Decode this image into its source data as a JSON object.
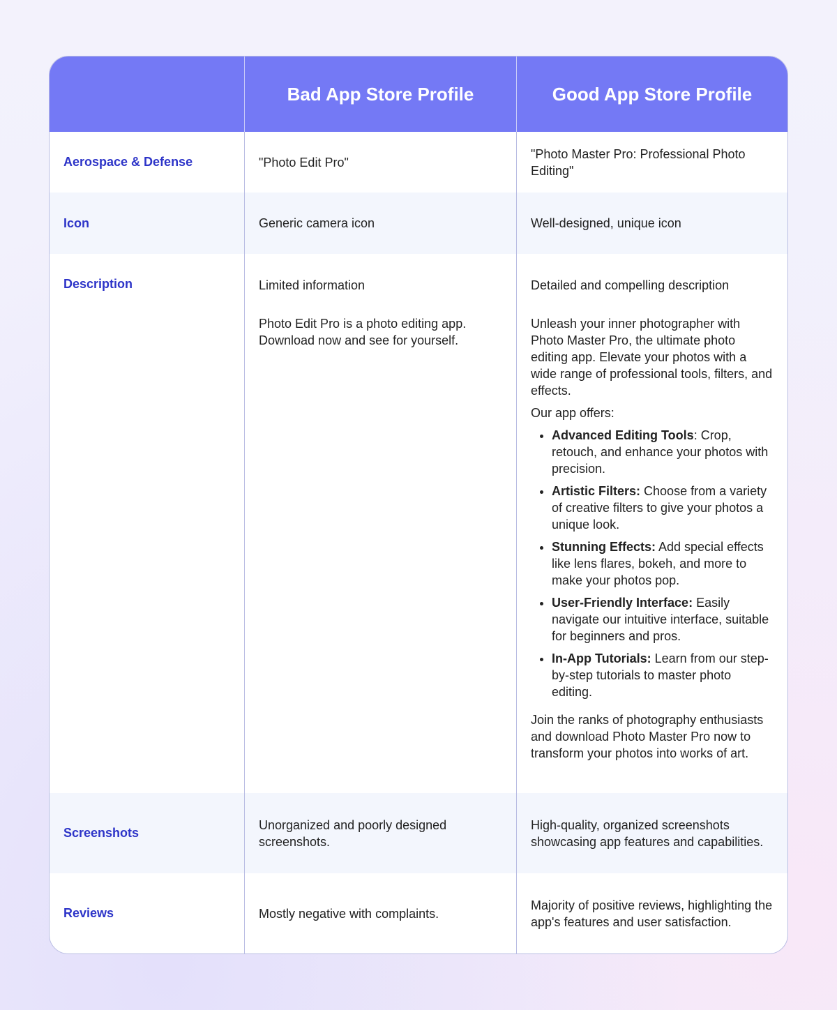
{
  "header": {
    "col1": "",
    "col2": "Bad App Store Profile",
    "col3": "Good App Store Profile"
  },
  "rows": {
    "name": {
      "label": "Aerospace & Defense",
      "bad": "\"Photo Edit Pro\"",
      "good": "\"Photo Master Pro: Professional Photo Editing\""
    },
    "icon": {
      "label": "Icon",
      "bad": "Generic camera icon",
      "good": "Well-designed, unique icon"
    },
    "description": {
      "label": "Description",
      "bad_title": "Limited information",
      "bad_body": "Photo Edit Pro is a photo editing app. Download now and see for yourself.",
      "good_title": "Detailed and compelling description",
      "good_intro": "Unleash your inner photographer with Photo Master Pro, the ultimate photo editing app. Elevate your photos with a wide range of professional tools, filters, and effects.",
      "good_offers": "Our app offers:",
      "features": [
        {
          "title": "Advanced Editing Tools",
          "text": ": Crop, retouch, and enhance your photos with precision."
        },
        {
          "title": "Artistic Filters:",
          "text": " Choose from a variety of creative filters to give your photos a unique look."
        },
        {
          "title": "Stunning Effects:",
          "text": " Add special effects like lens flares, bokeh, and more to make your photos pop."
        },
        {
          "title": "User-Friendly Interface:",
          "text": " Easily navigate our intuitive interface, suitable for beginners and pros."
        },
        {
          "title": "In-App Tutorials:",
          "text": " Learn from our step-by-step tutorials to master photo editing."
        }
      ],
      "good_outro": "Join the ranks of photography enthusiasts and download Photo Master Pro now to transform your photos into works of art."
    },
    "screenshots": {
      "label": "Screenshots",
      "bad": "Unorganized and poorly designed screenshots.",
      "good": "High-quality, organized screenshots showcasing app features and capabilities."
    },
    "reviews": {
      "label": "Reviews",
      "bad": "Mostly negative with complaints.",
      "good": "Majority of positive reviews, highlighting the app's features and user satisfaction."
    }
  }
}
